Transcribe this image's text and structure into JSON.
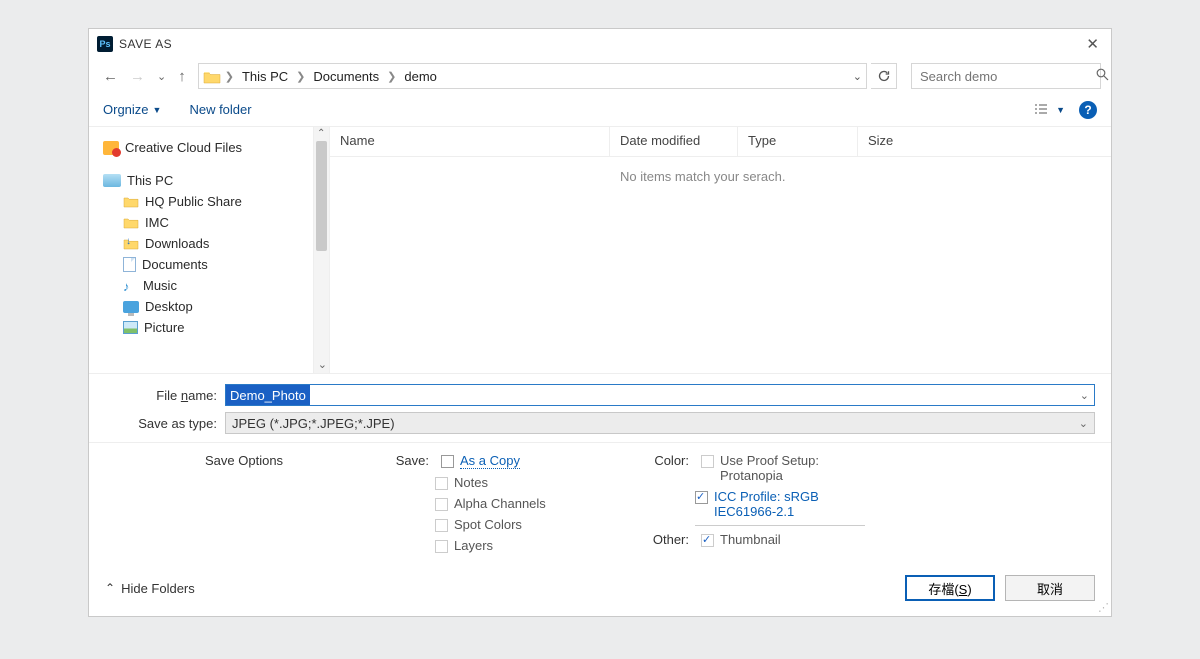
{
  "title": "SAVE AS",
  "breadcrumb": {
    "items": [
      "This PC",
      "Documents",
      "demo"
    ]
  },
  "search": {
    "placeholder": "Search demo"
  },
  "toolbar": {
    "organize": "Orgnize",
    "newfolder": "New folder"
  },
  "tree": {
    "creative": "Creative Cloud Files",
    "thispc": "This PC",
    "hq": "HQ Public Share",
    "imc": "IMC",
    "downloads": "Downloads",
    "documents": "Documents",
    "music": "Music",
    "desktop": "Desktop",
    "picture": "Picture"
  },
  "columns": {
    "name": "Name",
    "date": "Date modified",
    "type": "Type",
    "size": "Size"
  },
  "empty": "No items match your serach.",
  "form": {
    "filename_label": "File name:",
    "filename_value": "Demo_Photo",
    "type_label": "Save as type:",
    "type_value": "JPEG (*.JPG;*.JPEG;*.JPE)"
  },
  "options": {
    "heading": "Save Options",
    "save_label": "Save:",
    "as_copy": "As a Copy",
    "notes": "Notes",
    "alpha": "Alpha Channels",
    "spot": "Spot Colors",
    "layers": "Layers",
    "color_label": "Color:",
    "proof": "Use Proof Setup: Protanopia",
    "icc": "ICC Profile:  sRGB IEC61966-2.1",
    "other_label": "Other:",
    "thumbnail": "Thumbnail"
  },
  "footer": {
    "hide": "Hide Folders",
    "save_btn": "存檔(S)",
    "cancel_btn": "取消"
  }
}
